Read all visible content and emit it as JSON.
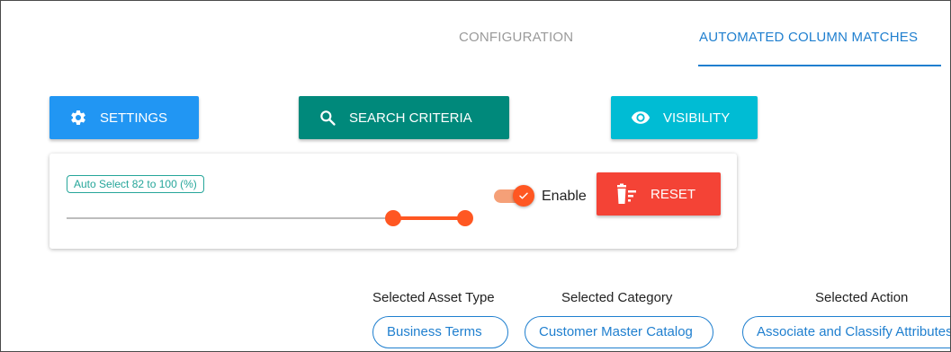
{
  "tabs": {
    "configuration": "CONFIGURATION",
    "automated_column_matches": "AUTOMATED COLUMN MATCHES",
    "active": "automated_column_matches"
  },
  "toolbar": {
    "settings_label": "SETTINGS",
    "search_criteria_label": "SEARCH CRITERIA",
    "visibility_label": "VISIBILITY"
  },
  "auto_select": {
    "label": "Auto Select 82 to 100 (%)",
    "min": 82,
    "max": 100,
    "range_min": 0,
    "range_max": 100,
    "enabled": true,
    "enable_label": "Enable",
    "reset_label": "RESET"
  },
  "selections": {
    "asset_type": {
      "label": "Selected Asset Type",
      "value": "Business Terms"
    },
    "category": {
      "label": "Selected Category",
      "value": "Customer Master Catalog"
    },
    "action": {
      "label": "Selected Action",
      "value": "Associate and Classify Attributes"
    }
  },
  "colors": {
    "primary_blue": "#2196f3",
    "teal": "#00897b",
    "cyan": "#00bcd4",
    "orange": "#ff5722",
    "red": "#f44336",
    "link_blue": "#1f7fcf"
  }
}
